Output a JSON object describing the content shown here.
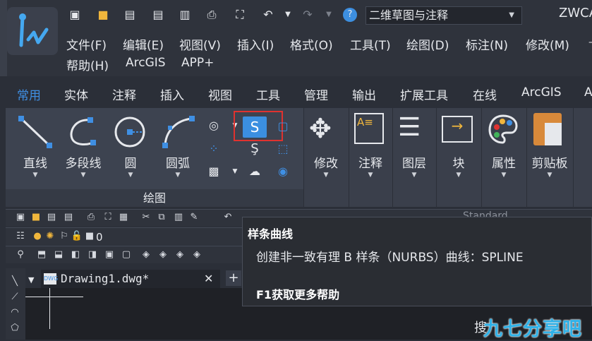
{
  "app": {
    "title": "ZWCA"
  },
  "workspace": {
    "selected": "二维草图与注释"
  },
  "menu_row1": [
    "文件(F)",
    "编辑(E)",
    "视图(V)",
    "插入(I)",
    "格式(O)",
    "工具(T)",
    "绘图(D)",
    "标注(N)",
    "修改(M)"
  ],
  "menu_row2": [
    "帮助(H)",
    "ArcGIS",
    "APP+"
  ],
  "tabs": [
    "常用",
    "实体",
    "注释",
    "插入",
    "视图",
    "工具",
    "管理",
    "输出",
    "扩展工具",
    "在线",
    "ArcGIS",
    "A"
  ],
  "draw_group": {
    "title": "绘图",
    "tools": [
      "直线",
      "多段线",
      "圆",
      "圆弧"
    ]
  },
  "other_groups": [
    "修改",
    "注释",
    "图层",
    "块",
    "属性",
    "剪贴板"
  ],
  "layer_row": {
    "value": "0"
  },
  "doc_tab": {
    "name": "Drawing1.dwg*"
  },
  "toolbar_text": {
    "style": "Standard"
  },
  "tooltip": {
    "title": "样条曲线",
    "description": "创建非一致有理 B 样条（NURBS）曲线：SPLINE",
    "help": "F1获取更多帮助"
  },
  "watermark": {
    "search": "搜",
    "text": "九七分享吧"
  },
  "colors": {
    "accent": "#3f8fe3",
    "highlight_border": "#e0322f",
    "spline_button": "#3b8fe0",
    "watermark": "#2fb1e8"
  }
}
